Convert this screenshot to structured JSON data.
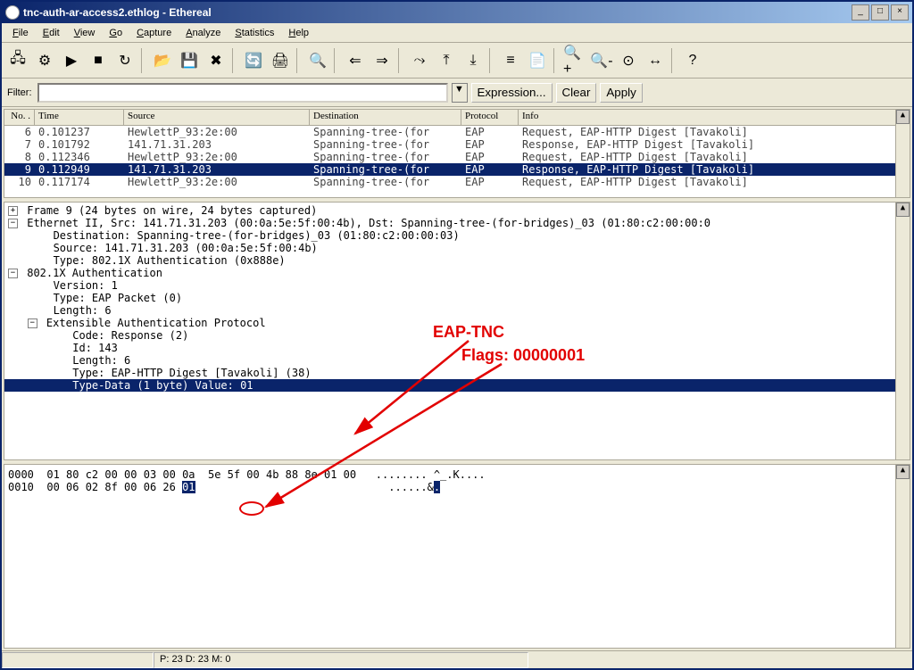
{
  "window": {
    "title": "tnc-auth-ar-access2.ethlog - Ethereal"
  },
  "menus": [
    "File",
    "Edit",
    "View",
    "Go",
    "Capture",
    "Analyze",
    "Statistics",
    "Help"
  ],
  "filter": {
    "label": "Filter:",
    "value": "",
    "expression_btn": "Expression...",
    "clear_btn": "Clear",
    "apply_btn": "Apply"
  },
  "packet_columns": [
    "No. .",
    "Time",
    "Source",
    "Destination",
    "Protocol",
    "Info"
  ],
  "packets": [
    {
      "no": "6",
      "time": "0.101237",
      "src": "HewlettP_93:2e:00",
      "dst": "Spanning-tree-(for",
      "proto": "EAP",
      "info": "Request, EAP-HTTP Digest [Tavakoli]",
      "sel": false
    },
    {
      "no": "7",
      "time": "0.101792",
      "src": "141.71.31.203",
      "dst": "Spanning-tree-(for",
      "proto": "EAP",
      "info": "Response, EAP-HTTP Digest [Tavakoli]",
      "sel": false
    },
    {
      "no": "8",
      "time": "0.112346",
      "src": "HewlettP_93:2e:00",
      "dst": "Spanning-tree-(for",
      "proto": "EAP",
      "info": "Request, EAP-HTTP Digest [Tavakoli]",
      "sel": false
    },
    {
      "no": "9",
      "time": "0.112949",
      "src": "141.71.31.203",
      "dst": "Spanning-tree-(for",
      "proto": "EAP",
      "info": "Response, EAP-HTTP Digest [Tavakoli]",
      "sel": true
    },
    {
      "no": "10",
      "time": "0.117174",
      "src": "HewlettP_93:2e:00",
      "dst": "Spanning-tree-(for",
      "proto": "EAP",
      "info": "Request, EAP-HTTP Digest [Tavakoli]",
      "sel": false
    }
  ],
  "details": [
    {
      "indent": 0,
      "exp": "+",
      "text": "Frame 9 (24 bytes on wire, 24 bytes captured)"
    },
    {
      "indent": 0,
      "exp": "-",
      "text": "Ethernet II, Src: 141.71.31.203 (00:0a:5e:5f:00:4b), Dst: Spanning-tree-(for-bridges)_03 (01:80:c2:00:00:0"
    },
    {
      "indent": 1,
      "text": "Destination: Spanning-tree-(for-bridges)_03 (01:80:c2:00:00:03)"
    },
    {
      "indent": 1,
      "text": "Source: 141.71.31.203 (00:0a:5e:5f:00:4b)"
    },
    {
      "indent": 1,
      "text": "Type: 802.1X Authentication (0x888e)"
    },
    {
      "indent": 0,
      "exp": "-",
      "text": "802.1X Authentication"
    },
    {
      "indent": 1,
      "text": "Version: 1"
    },
    {
      "indent": 1,
      "text": "Type: EAP Packet (0)"
    },
    {
      "indent": 1,
      "text": "Length: 6"
    },
    {
      "indent": 1,
      "exp": "-",
      "text": "Extensible Authentication Protocol"
    },
    {
      "indent": 2,
      "text": "Code: Response (2)"
    },
    {
      "indent": 2,
      "text": "Id: 143"
    },
    {
      "indent": 2,
      "text": "Length: 6"
    },
    {
      "indent": 2,
      "text": "Type: EAP-HTTP Digest [Tavakoli] (38)"
    },
    {
      "indent": 2,
      "text": "Type-Data (1 byte) Value: 01",
      "sel": true
    }
  ],
  "hex": {
    "lines": [
      {
        "off": "0000",
        "bytes": "01 80 c2 00 00 03 00 0a  5e 5f 00 4b 88 8e 01 00",
        "ascii": "........ ^_.K...."
      },
      {
        "off": "0010",
        "bytes_pre": "00 06 02 8f 00 06 26 ",
        "sel": "01",
        "ascii_pre": "......&",
        "ascii_sel": ".",
        "ascii_post": ""
      }
    ]
  },
  "status": {
    "left": "",
    "right": "P: 23 D: 23 M: 0"
  },
  "annotations": {
    "eaptnc": "EAP-TNC",
    "flags": "Flags: 00000001"
  },
  "toolbar_icons": [
    "interfaces",
    "capture-options",
    "start-capture",
    "stop-capture",
    "restart-capture",
    "sep",
    "open",
    "save",
    "close",
    "sep",
    "reload",
    "print",
    "sep",
    "find",
    "sep",
    "back",
    "forward",
    "sep",
    "goto",
    "top",
    "bottom",
    "sep",
    "colorize",
    "prefs",
    "sep",
    "zoom-in",
    "zoom-out",
    "zoom-100",
    "resize-cols",
    "sep",
    "help"
  ]
}
